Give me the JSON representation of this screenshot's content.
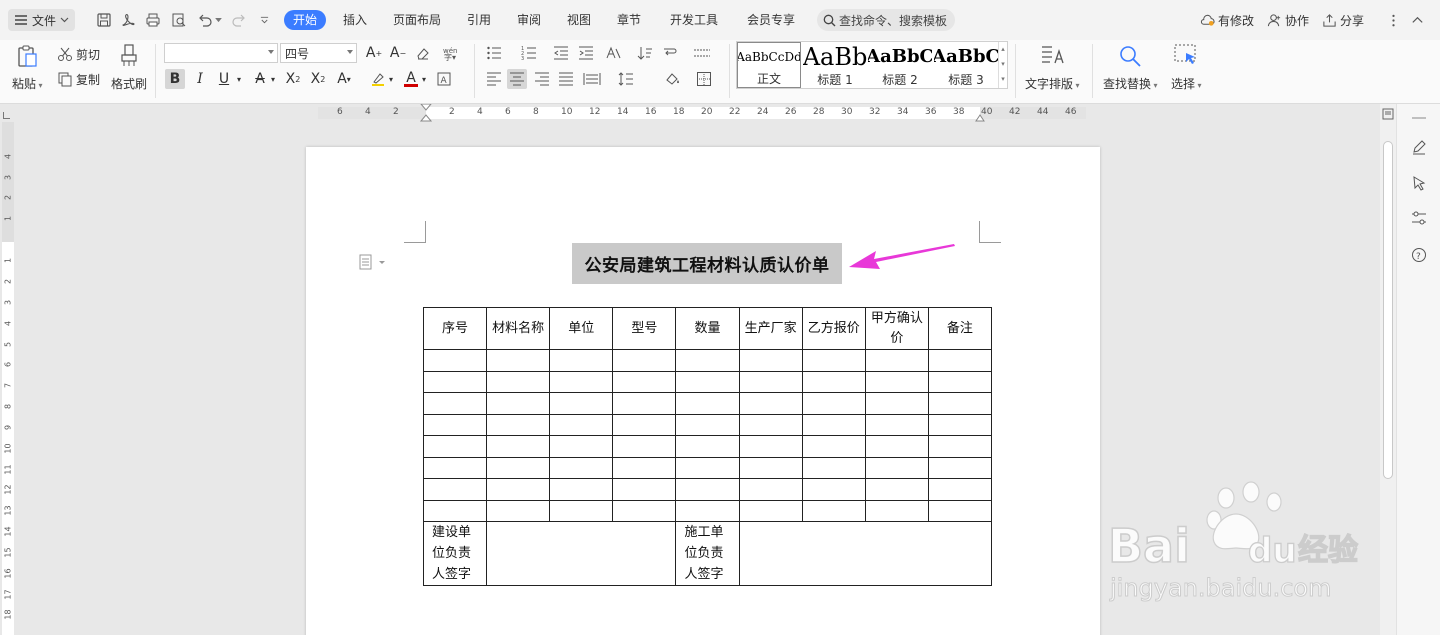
{
  "menubar": {
    "file_label": "文件",
    "tabs": [
      "开始",
      "插入",
      "页面布局",
      "引用",
      "审阅",
      "视图",
      "章节",
      "开发工具",
      "会员专享"
    ],
    "active_tab": "开始",
    "search_placeholder": "查找命令、搜索模板",
    "modified_label": "有修改",
    "collab_label": "协作",
    "share_label": "分享"
  },
  "ribbon": {
    "paste_label": "粘贴",
    "cut_label": "剪切",
    "copy_label": "复制",
    "format_painter_label": "格式刷",
    "font_name_value": "",
    "font_size_value": "四号",
    "styles": [
      {
        "sample": "AaBbCcDd",
        "name": "正文"
      },
      {
        "sample": "AaBb",
        "name": "标题 1"
      },
      {
        "sample": "AaBbC",
        "name": "标题 2"
      },
      {
        "sample": "AaBbC",
        "name": "标题 3"
      }
    ],
    "text_layout_label": "文字排版",
    "find_replace_label": "查找替换",
    "select_label": "选择"
  },
  "ruler": {
    "h_ticks": [
      "6",
      "4",
      "2",
      "2",
      "4",
      "6",
      "8",
      "10",
      "12",
      "14",
      "16",
      "18",
      "20",
      "22",
      "24",
      "26",
      "28",
      "30",
      "32",
      "34",
      "36",
      "38",
      "40",
      "42",
      "44",
      "46"
    ],
    "v_ticks": [
      "4",
      "3",
      "2",
      "1",
      "1",
      "2",
      "3",
      "4",
      "5",
      "6",
      "7",
      "8",
      "9",
      "10",
      "11",
      "12",
      "13",
      "14",
      "15",
      "16",
      "17",
      "18"
    ]
  },
  "document": {
    "title": "公安局建筑工程材料认质认价单",
    "table_headers": [
      "序号",
      "材料名称",
      "单位",
      "型号",
      "数量",
      "生产厂家",
      "乙方报价",
      "甲方确认价",
      "备注"
    ],
    "empty_rows": 8,
    "footer": {
      "builder_sign": "建设单位负责人签字",
      "constructor_sign": "施工单位负责人签字"
    }
  },
  "watermark": {
    "brand": "Bai",
    "brand2": "du",
    "cn": "经验",
    "url": "jingyan.baidu.com"
  },
  "colors": {
    "accent": "#3b7cff",
    "arrow": "#e838d8",
    "title_highlight": "#c9c9c9"
  }
}
